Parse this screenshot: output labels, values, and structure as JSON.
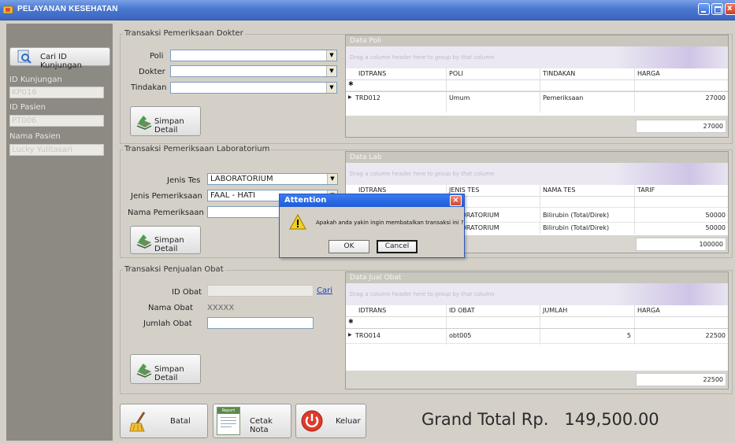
{
  "window": {
    "title": "PELAYANAN KESEHATAN"
  },
  "left": {
    "cari_button": "Cari ID Kunjungan",
    "id_kunjungan_label": "ID Kunjungan",
    "id_kunjungan_value": "KP016",
    "id_pasien_label": "ID Pasien",
    "id_pasien_value": "PT006",
    "nama_pasien_label": "Nama Pasien",
    "nama_pasien_value": "Lucky Yulitasari"
  },
  "dokter": {
    "group_title": "Transaksi Pemeriksaan Dokter",
    "poli_label": "Poli",
    "dokter_label": "Dokter",
    "tindakan_label": "Tindakan",
    "simpan": "Simpan Detail"
  },
  "poli_grid": {
    "title": "Data Poli",
    "drag_hint": "Drag a column header here to group by that column",
    "columns": [
      "IDTRANS",
      "POLI",
      "TINDAKAN",
      "HARGA"
    ],
    "rows": [
      [
        "TRD012",
        "Umum",
        "Pemeriksaan",
        "27000"
      ]
    ],
    "total": "27000"
  },
  "lab": {
    "group_title": "Transaksi Pemeriksaan Laboratorium",
    "jenis_tes_label": "Jenis Tes",
    "jenis_tes_value": "LABORATORIUM",
    "jenis_pemeriksaan_label": "Jenis Pemeriksaan",
    "jenis_pemeriksaan_value": "FAAL - HATI",
    "nama_pemeriksaan_label": "Nama Pemeriksaan",
    "simpan": "Simpan Detail"
  },
  "lab_grid": {
    "title": "Data Lab",
    "drag_hint": "Drag a column header here to group by that column",
    "columns": [
      "IDTRANS",
      "JENIS TES",
      "NAMA TES",
      "TARIF"
    ],
    "rows": [
      [
        "",
        "LABORATORIUM",
        "Bilirubin (Total/Direk)",
        "50000"
      ],
      [
        "",
        "LABORATORIUM",
        "Bilirubin (Total/Direk)",
        "50000"
      ]
    ],
    "total": "100000"
  },
  "obat": {
    "group_title": "Transaksi Penjualan Obat",
    "id_obat_label": "ID Obat",
    "cari_link": "Cari",
    "nama_obat_label": "Nama Obat",
    "nama_obat_value": "XXXXX",
    "jumlah_obat_label": "Jumlah Obat",
    "simpan": "Simpan Detail"
  },
  "obat_grid": {
    "title": "Data Jual Obat",
    "drag_hint": "Drag a column header here to group by that column",
    "columns": [
      "IDTRANS",
      "ID OBAT",
      "JUMLAH",
      "HARGA"
    ],
    "rows": [
      [
        "TRO014",
        "obt005",
        "5",
        "22500"
      ]
    ],
    "total": "22500"
  },
  "bottom": {
    "batal": "Batal",
    "cetak_icon_label": "Report",
    "cetak": "Cetak Nota",
    "keluar": "Keluar",
    "grand_total": "Grand Total Rp.   149,500.00"
  },
  "dialog": {
    "title": "Attention",
    "message": "Apakah anda yakin ingin membatalkan transaksi ini ?",
    "ok": "OK",
    "cancel": "Cancel"
  },
  "colors": {
    "titlebar": "#3a66c0",
    "panel": "#8d8a84",
    "dialog_title": "#1e5cd8"
  }
}
